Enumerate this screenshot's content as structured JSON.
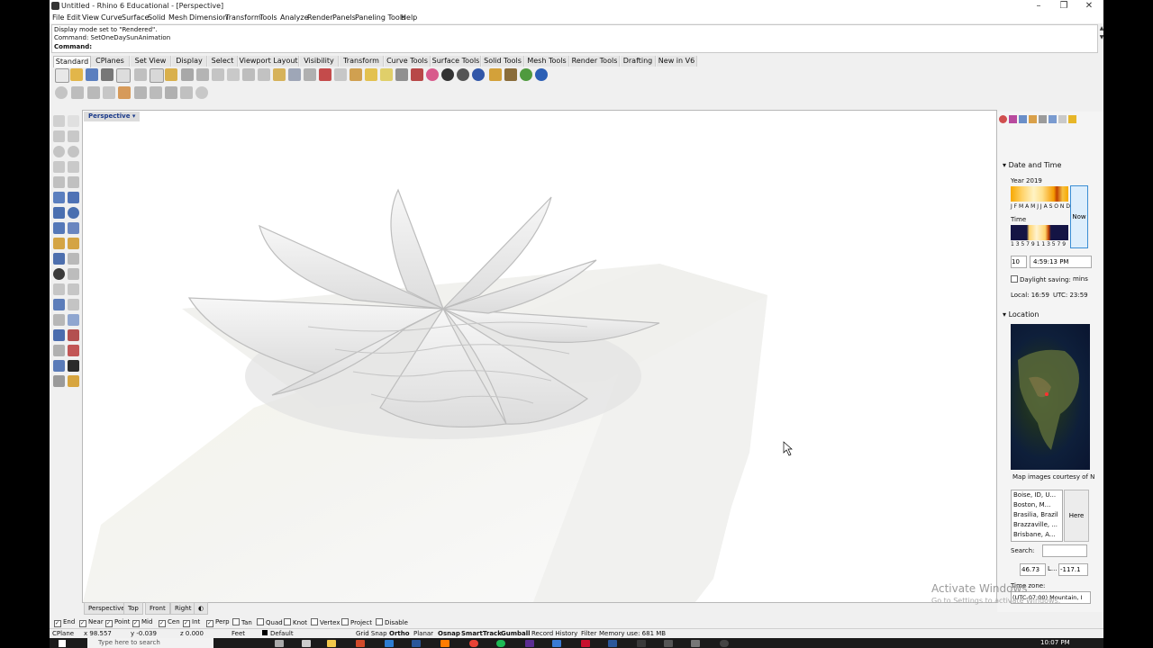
{
  "window": {
    "title": "Untitled - Rhino 6 Educational - [Perspective]"
  },
  "menu": [
    "File",
    "Edit",
    "View",
    "Curve",
    "Surface",
    "Solid",
    "Mesh",
    "Dimension",
    "Transform",
    "Tools",
    "Analyze",
    "Render",
    "Panels",
    "Paneling Tools",
    "Help"
  ],
  "command_history": [
    "Display mode set to \"Rendered\".",
    "Command: SetOneDaySunAnimation"
  ],
  "command_prompt": "Command:",
  "toolbar_tabs": [
    "Standard",
    "CPlanes",
    "Set View",
    "Display",
    "Select",
    "Viewport Layout",
    "Visibility",
    "Transform",
    "Curve Tools",
    "Surface Tools",
    "Solid Tools",
    "Mesh Tools",
    "Render Tools",
    "Drafting",
    "New in V6"
  ],
  "viewport": {
    "label": "Perspective"
  },
  "viewport_tabs": [
    "Perspective",
    "Top",
    "Front",
    "Right"
  ],
  "osnap": [
    {
      "label": "End",
      "checked": true
    },
    {
      "label": "Near",
      "checked": true
    },
    {
      "label": "Point",
      "checked": true
    },
    {
      "label": "Mid",
      "checked": true
    },
    {
      "label": "Cen",
      "checked": true
    },
    {
      "label": "Int",
      "checked": true
    },
    {
      "label": "Perp",
      "checked": true
    },
    {
      "label": "Tan",
      "checked": false
    },
    {
      "label": "Quad",
      "checked": false
    },
    {
      "label": "Knot",
      "checked": false
    },
    {
      "label": "Vertex",
      "checked": false
    },
    {
      "label": "Project",
      "checked": false
    },
    {
      "label": "Disable",
      "checked": false
    }
  ],
  "status": {
    "cplane": "CPlane",
    "x": "x 98.557",
    "y": "y -0.039",
    "z": "z 0.000",
    "units": "Feet",
    "layer": "Default",
    "toggles": [
      "Grid Snap",
      "Ortho",
      "Planar",
      "Osnap",
      "SmartTrack",
      "Gumball",
      "Record History",
      "Filter"
    ],
    "memory": "Memory use: 681 MB"
  },
  "sun_panel": {
    "date_time_header": "Date and Time",
    "year_label": "Year 2019",
    "months": "J F M A M J J A S O N D",
    "now_button": "Now",
    "time_label": "Time",
    "hours": "1 3 5 7 9 1 1 3 5 7 9",
    "day_value": "10",
    "time_value": "4:59:13 PM",
    "daylight_saving": "Daylight saving:",
    "mins": "mins",
    "local": "Local: 16:59",
    "utc": "UTC: 23:59",
    "location_header": "Location",
    "map_credit": "Map images courtesy of N",
    "cities": [
      "Boise, ID, U...",
      "Boston, M...",
      "Brasilia, Brazil",
      "Brazzaville, ...",
      "Brisbane, A..."
    ],
    "here_button": "Here",
    "search_label": "Search:",
    "lat_value": "46.73",
    "lon_label": "L...",
    "lon_value": "-117.1",
    "timezone_label": "Time zone:",
    "timezone_value": "(UTC-07:00) Mountain, I"
  },
  "watermark": {
    "line1": "Activate Windows",
    "line2": "Go to Settings to activate Windows."
  },
  "taskbar": {
    "search_placeholder": "Type here to search",
    "clock": "10:07 PM"
  }
}
